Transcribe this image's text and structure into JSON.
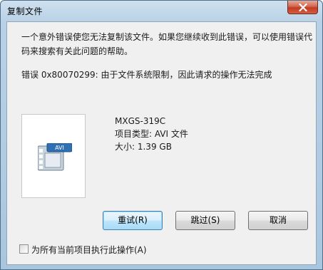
{
  "window": {
    "title": "复制文件"
  },
  "message": "一个意外错误使您无法复制该文件。如果您继续收到此错误，可以使用错误代码来搜索有关此问题的帮助。",
  "error": "错误 0x80070299: 由于文件系统限制，因此请求的操作无法完成",
  "file": {
    "name": "MXGS-319C",
    "type": "项目类型: AVI 文件",
    "size": "大小: 1.39 GB",
    "icon_badge": "AVI"
  },
  "buttons": {
    "retry": "重试(R)",
    "skip": "跳过(S)",
    "cancel": "取消"
  },
  "checkbox": {
    "label": "为所有当前项目执行此操作(A)",
    "checked": false
  },
  "colors": {
    "close_button": "#c23a22",
    "default_button_border": "#3c7fb1",
    "frame": "#b9d1e6",
    "client_background": "#f0f0f0"
  },
  "icons": [
    "close-icon",
    "avi-file-icon"
  ]
}
